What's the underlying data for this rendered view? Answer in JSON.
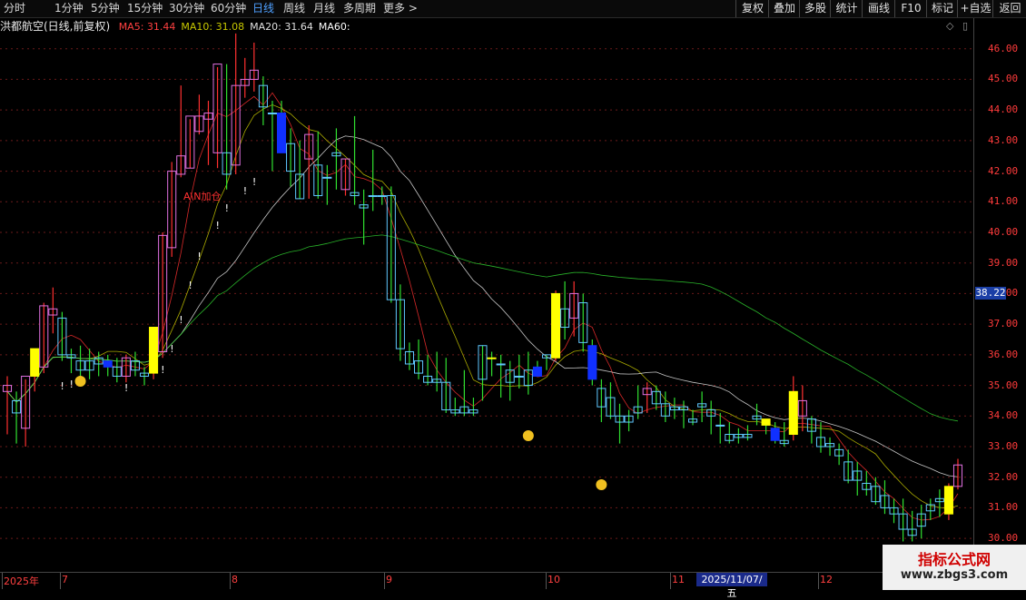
{
  "toolbar": {
    "periods": [
      "分时",
      "1分钟",
      "5分钟",
      "15分钟",
      "30分钟",
      "60分钟",
      "日线",
      "周线",
      "月线",
      "多周期",
      "更多 >"
    ],
    "active_period": "日线",
    "right_buttons": [
      "复权",
      "叠加",
      "多股",
      "统计",
      "画线",
      "F10",
      "标记",
      "+自选",
      "返回"
    ]
  },
  "header": {
    "stock_title": "洪都航空(日线,前复权)",
    "indicators": [
      {
        "label": "MA5: 31.44",
        "color": "#ff4040"
      },
      {
        "label": "MA10: 31.08",
        "color": "#c8c800"
      },
      {
        "label": "MA20: 31.64",
        "color": "#e0e0e0"
      },
      {
        "label": "MA60:",
        "color": "#ffffff"
      }
    ]
  },
  "price_axis": {
    "labels": [
      "46.00",
      "45.00",
      "44.00",
      "43.00",
      "42.00",
      "41.00",
      "40.00",
      "39.00",
      "38.00",
      "37.00",
      "36.00",
      "35.00",
      "34.00",
      "33.00",
      "32.00",
      "31.00",
      "30.00"
    ],
    "current_price": "38.22"
  },
  "annotation": {
    "text": "A\\N加仓"
  },
  "time_axis": {
    "labels": [
      "2025年",
      "7",
      "8",
      "9",
      "10",
      "11",
      "12"
    ],
    "cursor_date": "2025/11/07/五"
  },
  "watermark": {
    "title": "指标公式网",
    "url": "www.zbgs3.com"
  },
  "chart_data": {
    "type": "candlestick",
    "title": "洪都航空(日线,前复权)",
    "ylim": [
      29.5,
      47.0
    ],
    "candles": [
      [
        35.0,
        35.3,
        33.4,
        34.8,
        "up"
      ],
      [
        34.5,
        34.8,
        33.1,
        34.1,
        "down"
      ],
      [
        33.6,
        35.2,
        33.0,
        35.3,
        "up"
      ],
      [
        35.3,
        36.2,
        34.8,
        36.2,
        "yup"
      ],
      [
        35.6,
        37.7,
        35.4,
        37.6,
        "up"
      ],
      [
        37.3,
        38.2,
        36.7,
        37.5,
        "up"
      ],
      [
        37.2,
        37.4,
        35.8,
        36.0,
        "down"
      ],
      [
        36.0,
        36.2,
        35.4,
        35.9,
        "down"
      ],
      [
        35.8,
        36.3,
        35.1,
        35.5,
        "down"
      ],
      [
        35.5,
        36.2,
        35.2,
        35.8,
        "down"
      ],
      [
        35.9,
        36.1,
        35.3,
        35.7,
        "down"
      ],
      [
        35.8,
        36.0,
        35.3,
        35.6,
        "bdown"
      ],
      [
        35.6,
        35.9,
        35.1,
        35.3,
        "down"
      ],
      [
        35.3,
        36.0,
        35.1,
        35.9,
        "up"
      ],
      [
        35.8,
        36.1,
        35.3,
        35.5,
        "down"
      ],
      [
        35.3,
        35.6,
        35.0,
        35.4,
        "down"
      ],
      [
        35.4,
        36.9,
        35.2,
        36.9,
        "yup"
      ],
      [
        36.1,
        40.0,
        35.9,
        39.9,
        "up"
      ],
      [
        39.5,
        42.3,
        39.2,
        42.0,
        "up"
      ],
      [
        41.9,
        44.8,
        41.8,
        42.5,
        "up"
      ],
      [
        42.1,
        43.7,
        42.1,
        43.8,
        "up"
      ],
      [
        43.3,
        44.5,
        43.2,
        43.8,
        "up"
      ],
      [
        43.7,
        44.3,
        42.2,
        43.9,
        "up"
      ],
      [
        42.6,
        45.4,
        42.1,
        45.5,
        "up"
      ],
      [
        42.6,
        45.5,
        41.4,
        41.9,
        "down"
      ],
      [
        42.2,
        46.5,
        41.9,
        44.8,
        "up"
      ],
      [
        44.8,
        45.7,
        44.4,
        45.0,
        "up"
      ],
      [
        45.3,
        46.2,
        44.6,
        45.0,
        "up"
      ],
      [
        44.8,
        45.1,
        43.5,
        44.1,
        "down"
      ],
      [
        43.9,
        44.3,
        42.0,
        43.9,
        "down"
      ],
      [
        43.9,
        44.3,
        42.8,
        42.6,
        "bdown"
      ],
      [
        42.9,
        43.4,
        41.5,
        42.0,
        "down"
      ],
      [
        41.9,
        43.0,
        41.1,
        41.1,
        "down"
      ],
      [
        42.4,
        43.5,
        41.1,
        43.2,
        "up"
      ],
      [
        42.2,
        43.3,
        41.1,
        41.2,
        "down"
      ],
      [
        41.8,
        42.2,
        40.9,
        41.8,
        "down"
      ],
      [
        42.6,
        43.4,
        41.4,
        42.5,
        "down"
      ],
      [
        41.4,
        42.4,
        41.2,
        42.4,
        "up"
      ],
      [
        41.3,
        43.8,
        40.9,
        41.2,
        "down"
      ],
      [
        40.8,
        41.4,
        39.6,
        40.9,
        "down"
      ],
      [
        41.2,
        42.7,
        40.7,
        41.2,
        "down"
      ],
      [
        41.2,
        41.5,
        40.9,
        41.2,
        "down"
      ],
      [
        41.2,
        41.5,
        37.7,
        37.8,
        "down"
      ],
      [
        37.8,
        38.3,
        35.8,
        36.2,
        "down"
      ],
      [
        36.1,
        36.4,
        35.5,
        35.7,
        "down"
      ],
      [
        35.8,
        36.5,
        35.2,
        35.4,
        "down"
      ],
      [
        35.3,
        36.0,
        35.0,
        35.1,
        "down"
      ],
      [
        35.2,
        36.1,
        34.8,
        35.1,
        "down"
      ],
      [
        35.1,
        35.9,
        34.1,
        34.2,
        "down"
      ],
      [
        34.2,
        34.6,
        34.0,
        34.1,
        "down"
      ],
      [
        34.3,
        35.5,
        34.0,
        34.1,
        "down"
      ],
      [
        34.2,
        34.6,
        34.0,
        34.1,
        "down"
      ],
      [
        35.2,
        36.3,
        34.5,
        36.3,
        "down"
      ],
      [
        35.9,
        36.1,
        35.3,
        35.9,
        "ydown"
      ],
      [
        35.7,
        36.0,
        34.6,
        35.7,
        "down"
      ],
      [
        35.5,
        35.8,
        34.5,
        35.1,
        "down"
      ],
      [
        35.3,
        36.0,
        34.9,
        35.3,
        "down"
      ],
      [
        35.5,
        36.1,
        34.7,
        35.0,
        "down"
      ],
      [
        35.6,
        35.8,
        35.3,
        35.3,
        "bdown"
      ],
      [
        36.0,
        36.0,
        35.5,
        35.9,
        "down"
      ],
      [
        35.9,
        38.1,
        35.8,
        38.0,
        "yup"
      ],
      [
        37.5,
        38.4,
        36.5,
        36.9,
        "down"
      ],
      [
        37.2,
        38.4,
        36.6,
        38.0,
        "up"
      ],
      [
        37.7,
        38.0,
        36.1,
        36.4,
        "down"
      ],
      [
        36.3,
        36.5,
        35.0,
        35.2,
        "bdown"
      ],
      [
        34.9,
        35.2,
        33.8,
        34.3,
        "down"
      ],
      [
        34.6,
        35.1,
        33.9,
        34.0,
        "down"
      ],
      [
        34.0,
        34.4,
        33.1,
        33.8,
        "down"
      ],
      [
        33.8,
        34.2,
        33.5,
        34.0,
        "down"
      ],
      [
        34.1,
        35.0,
        33.9,
        34.3,
        "down"
      ],
      [
        34.7,
        35.1,
        34.1,
        34.9,
        "up"
      ],
      [
        34.8,
        35.0,
        34.2,
        34.4,
        "down"
      ],
      [
        34.4,
        34.8,
        33.8,
        34.0,
        "down"
      ],
      [
        34.3,
        34.6,
        33.9,
        34.2,
        "down"
      ],
      [
        34.2,
        34.5,
        33.6,
        34.3,
        "down"
      ],
      [
        33.9,
        34.2,
        33.7,
        33.8,
        "down"
      ],
      [
        34.4,
        34.8,
        33.8,
        34.3,
        "down"
      ],
      [
        34.2,
        34.5,
        33.4,
        34.0,
        "down"
      ],
      [
        33.7,
        34.1,
        33.1,
        33.7,
        "down"
      ],
      [
        33.4,
        33.8,
        33.1,
        33.2,
        "down"
      ],
      [
        33.4,
        33.6,
        33.1,
        33.3,
        "down"
      ],
      [
        33.3,
        33.7,
        33.2,
        33.4,
        "down"
      ],
      [
        33.9,
        34.4,
        33.7,
        34.0,
        "down"
      ],
      [
        33.9,
        33.8,
        33.4,
        33.7,
        "ydown"
      ],
      [
        33.6,
        33.8,
        33.1,
        33.2,
        "bdown"
      ],
      [
        33.2,
        33.8,
        33.0,
        33.1,
        "down"
      ],
      [
        33.4,
        35.3,
        33.2,
        34.8,
        "yup"
      ],
      [
        34.5,
        35.0,
        33.5,
        34.0,
        "up"
      ],
      [
        33.9,
        34.0,
        33.1,
        33.5,
        "down"
      ],
      [
        33.3,
        33.8,
        32.8,
        33.0,
        "down"
      ],
      [
        33.1,
        33.3,
        32.7,
        33.0,
        "down"
      ],
      [
        32.9,
        33.1,
        32.4,
        32.7,
        "down"
      ],
      [
        32.5,
        32.9,
        31.8,
        31.9,
        "down"
      ],
      [
        32.2,
        32.5,
        31.4,
        31.9,
        "down"
      ],
      [
        31.8,
        32.2,
        31.4,
        31.6,
        "down"
      ],
      [
        31.7,
        32.0,
        31.1,
        31.2,
        "down"
      ],
      [
        31.4,
        31.9,
        30.8,
        31.0,
        "down"
      ],
      [
        31.0,
        31.3,
        30.5,
        30.8,
        "down"
      ],
      [
        30.8,
        31.3,
        29.9,
        30.3,
        "down"
      ],
      [
        30.3,
        30.9,
        29.9,
        30.1,
        "down"
      ],
      [
        30.4,
        31.1,
        30.0,
        30.8,
        "down"
      ],
      [
        30.9,
        31.3,
        30.6,
        31.1,
        "down"
      ],
      [
        31.2,
        31.6,
        30.7,
        31.3,
        "down"
      ],
      [
        30.8,
        31.8,
        30.6,
        31.7,
        "yup"
      ],
      [
        31.7,
        32.6,
        31.6,
        32.4,
        "up"
      ]
    ]
  }
}
